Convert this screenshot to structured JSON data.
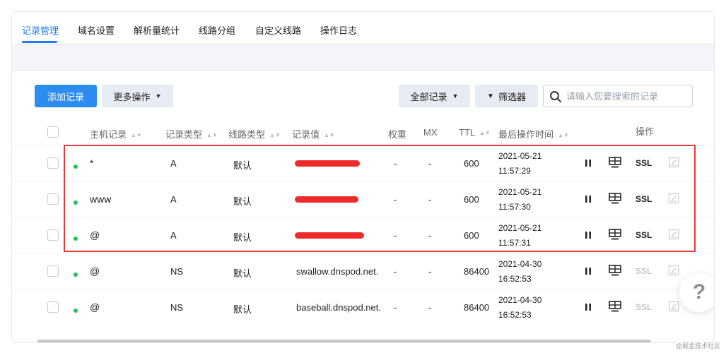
{
  "tabs": [
    {
      "label": "记录管理",
      "active": true
    },
    {
      "label": "域名设置"
    },
    {
      "label": "解析量统计"
    },
    {
      "label": "线路分组"
    },
    {
      "label": "自定义线路"
    },
    {
      "label": "操作日志"
    }
  ],
  "toolbar": {
    "add_label": "添加记录",
    "more_label": "更多操作",
    "all_records_label": "全部记录",
    "filter_label": "筛选器",
    "search_placeholder": "请输入您要搜索的记录"
  },
  "table": {
    "headers": {
      "host": "主机记录",
      "type": "记录类型",
      "line": "线路类型",
      "value": "记录值",
      "weight": "权重",
      "mx": "MX",
      "ttl": "TTL",
      "last_op": "最后操作时间",
      "actions": "操作"
    },
    "rows": [
      {
        "host": "*",
        "type": "A",
        "line": "默认",
        "value": "",
        "redacted": true,
        "weight": "-",
        "mx": "-",
        "ttl": "600",
        "date": "2021-05-21",
        "time": "11:57:29",
        "ssl": "SSL",
        "ssl_enabled": true
      },
      {
        "host": "www",
        "type": "A",
        "line": "默认",
        "value": "",
        "redacted": true,
        "weight": "-",
        "mx": "-",
        "ttl": "600",
        "date": "2021-05-21",
        "time": "11:57:30",
        "ssl": "SSL",
        "ssl_enabled": true
      },
      {
        "host": "@",
        "type": "A",
        "line": "默认",
        "value": "",
        "redacted": true,
        "weight": "-",
        "mx": "-",
        "ttl": "600",
        "date": "2021-05-21",
        "time": "11:57:31",
        "ssl": "SSL",
        "ssl_enabled": true
      },
      {
        "host": "@",
        "type": "NS",
        "line": "默认",
        "value": "swallow.dnspod.net.",
        "redacted": false,
        "weight": "-",
        "mx": "-",
        "ttl": "86400",
        "date": "2021-04-30",
        "time": "16:52:53",
        "ssl": "SSL",
        "ssl_enabled": false
      },
      {
        "host": "@",
        "type": "NS",
        "line": "默认",
        "value": "baseball.dnspod.net.",
        "redacted": false,
        "weight": "-",
        "mx": "-",
        "ttl": "86400",
        "date": "2021-04-30",
        "time": "16:52:53",
        "ssl": "SSL",
        "ssl_enabled": false
      }
    ]
  },
  "help_label": "?",
  "watermark": "@掘金技术社区",
  "colors": {
    "accent": "#1f7bf2",
    "primary_button": "#2d8cf0",
    "status_active": "#21c15b",
    "highlight_box": "#e03a3a",
    "redaction": "#ee2b2b"
  }
}
